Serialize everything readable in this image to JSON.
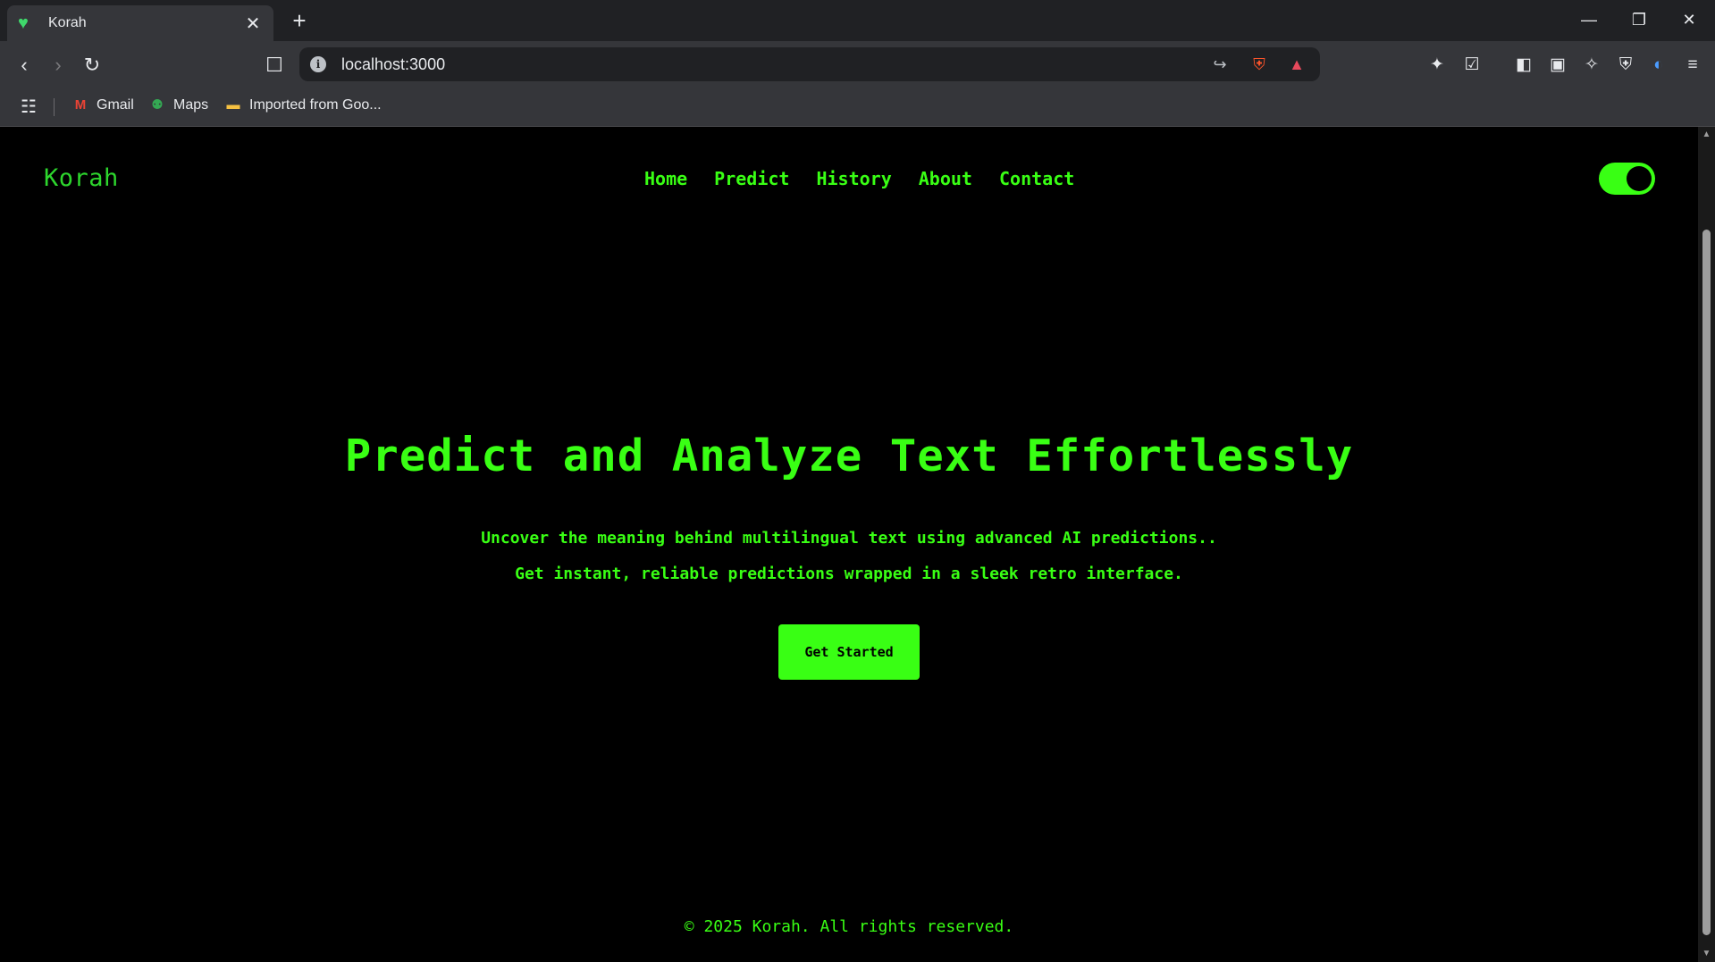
{
  "browser": {
    "tab_title": "Korah",
    "tab_favicon": "green-heart-icon",
    "url": "localhost:3000",
    "bookmarks": [
      {
        "label": "Gmail",
        "icon": "gmail-icon"
      },
      {
        "label": "Maps",
        "icon": "maps-pin-icon"
      },
      {
        "label": "Imported from Goo...",
        "icon": "folder-icon"
      }
    ]
  },
  "site": {
    "logo": "Korah",
    "nav": [
      "Home",
      "Predict",
      "History",
      "About",
      "Contact"
    ],
    "theme_toggle_on": true
  },
  "hero": {
    "title": "Predict and Analyze Text Effortlessly",
    "line1": "Uncover the meaning behind multilingual text using advanced AI predictions..",
    "line2": "Get instant, reliable predictions wrapped in a sleek retro interface.",
    "cta": "Get Started"
  },
  "footer": {
    "text": "© 2025 Korah. All rights reserved."
  },
  "colors": {
    "accent": "#39ff14",
    "background": "#000000",
    "chrome_dark": "#202124",
    "chrome_mid": "#35363a"
  }
}
